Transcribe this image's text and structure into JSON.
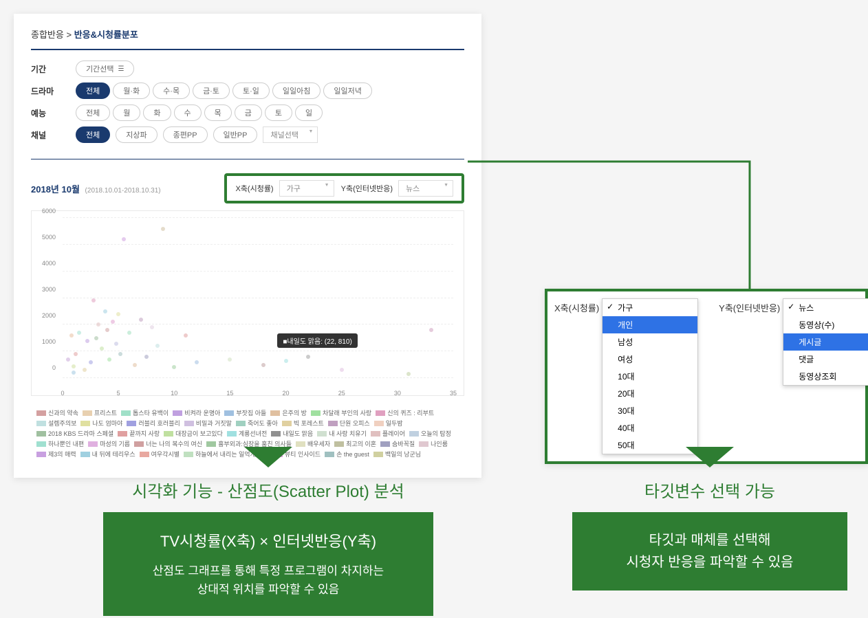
{
  "breadcrumb": {
    "parent": "종합반응",
    "sep": ">",
    "current": "반응&시청률분포"
  },
  "filters": {
    "period_label": "기간",
    "period_button": "기간선택",
    "drama_label": "드라마",
    "drama_options": [
      "전체",
      "월·화",
      "수·목",
      "금·토",
      "토·일",
      "일일아침",
      "일일저녁"
    ],
    "variety_label": "예능",
    "variety_options": [
      "전체",
      "월",
      "화",
      "수",
      "목",
      "금",
      "토",
      "일"
    ],
    "channel_label": "채널",
    "channel_options": [
      "전체",
      "지상파",
      "종편PP",
      "일반PP"
    ],
    "channel_select": "채널선택"
  },
  "date": {
    "title": "2018년 10월",
    "range": "(2018.10.01-2018.10.31)"
  },
  "axis_selectors": {
    "x_label": "X축(시청률)",
    "x_value": "가구",
    "y_label": "Y축(인터넷반응)",
    "y_value": "뉴스"
  },
  "chart_data": {
    "type": "scatter",
    "xlabel": "시청률",
    "ylabel": "인터넷반응",
    "xlim": [
      0,
      35
    ],
    "ylim": [
      0,
      6000
    ],
    "xticks": [
      0,
      5,
      10,
      15,
      20,
      25,
      30,
      35
    ],
    "yticks": [
      0,
      1000,
      2000,
      3000,
      4000,
      5000,
      6000
    ],
    "tooltip": "■내일도 맑음: (22, 810)",
    "points": [
      {
        "x": 0.5,
        "y": 700,
        "c": "#c8a8d8"
      },
      {
        "x": 0.8,
        "y": 1600,
        "c": "#e8c0a0"
      },
      {
        "x": 1.0,
        "y": 200,
        "c": "#a0c8e0"
      },
      {
        "x": 1.0,
        "y": 450,
        "c": "#d0e0a0"
      },
      {
        "x": 1.2,
        "y": 900,
        "c": "#e0a0a0"
      },
      {
        "x": 1.5,
        "y": 1700,
        "c": "#a0e0d0"
      },
      {
        "x": 2.0,
        "y": 300,
        "c": "#e0d0a0"
      },
      {
        "x": 2.2,
        "y": 1400,
        "c": "#c0a0e0"
      },
      {
        "x": 2.5,
        "y": 600,
        "c": "#a0a0e0"
      },
      {
        "x": 2.8,
        "y": 2900,
        "c": "#e0a0c0"
      },
      {
        "x": 3.0,
        "y": 1500,
        "c": "#a0c0a0"
      },
      {
        "x": 3.2,
        "y": 2000,
        "c": "#e0c0c0"
      },
      {
        "x": 3.5,
        "y": 1100,
        "c": "#c0e0a0"
      },
      {
        "x": 3.8,
        "y": 2500,
        "c": "#a0d0e0"
      },
      {
        "x": 4.0,
        "y": 1800,
        "c": "#d0a0a0"
      },
      {
        "x": 4.2,
        "y": 700,
        "c": "#a0e0a0"
      },
      {
        "x": 4.5,
        "y": 2100,
        "c": "#e0a0d0"
      },
      {
        "x": 4.8,
        "y": 1300,
        "c": "#c0c0e0"
      },
      {
        "x": 5.0,
        "y": 2400,
        "c": "#e0e0a0"
      },
      {
        "x": 5.2,
        "y": 900,
        "c": "#a0c0c0"
      },
      {
        "x": 5.5,
        "y": 5200,
        "c": "#d0a0e0"
      },
      {
        "x": 6.0,
        "y": 1700,
        "c": "#a0e0c0"
      },
      {
        "x": 6.5,
        "y": 500,
        "c": "#e0c0a0"
      },
      {
        "x": 7.0,
        "y": 2200,
        "c": "#c0a0c0"
      },
      {
        "x": 7.5,
        "y": 800,
        "c": "#a0a0c0"
      },
      {
        "x": 8.0,
        "y": 1900,
        "c": "#e0d0e0"
      },
      {
        "x": 8.5,
        "y": 1200,
        "c": "#c0e0e0"
      },
      {
        "x": 9.0,
        "y": 5600,
        "c": "#d0c0a0"
      },
      {
        "x": 10.0,
        "y": 400,
        "c": "#a0d0a0"
      },
      {
        "x": 11.0,
        "y": 1600,
        "c": "#e0a0a0"
      },
      {
        "x": 12.0,
        "y": 600,
        "c": "#a0c0e0"
      },
      {
        "x": 15.0,
        "y": 700,
        "c": "#d0e0c0"
      },
      {
        "x": 18.0,
        "y": 500,
        "c": "#c0a0a0"
      },
      {
        "x": 20.0,
        "y": 650,
        "c": "#a0e0e0"
      },
      {
        "x": 22.0,
        "y": 810,
        "c": "#a0a0a0"
      },
      {
        "x": 25.0,
        "y": 300,
        "c": "#e0c0e0"
      },
      {
        "x": 31.0,
        "y": 150,
        "c": "#c0d0a0"
      },
      {
        "x": 33.0,
        "y": 1800,
        "c": "#d0a0c0"
      }
    ],
    "legend": [
      {
        "label": "신과의 약속",
        "c": "#d4a0a0"
      },
      {
        "label": "프리스트",
        "c": "#e8d0b0"
      },
      {
        "label": "톱스타 유백이",
        "c": "#a0e0c8"
      },
      {
        "label": "비켜라 운명아",
        "c": "#c0a0e0"
      },
      {
        "label": "부잣집 아들",
        "c": "#a0c0e0"
      },
      {
        "label": "은주의 방",
        "c": "#e0c0a0"
      },
      {
        "label": "차달래 부인의 사랑",
        "c": "#a0e0a0"
      },
      {
        "label": "신의 퀴즈 : 리부트",
        "c": "#e0a0c0"
      },
      {
        "label": "설렘주의보",
        "c": "#c0e0e0"
      },
      {
        "label": "나도 엄마야",
        "c": "#e0e0a0"
      },
      {
        "label": "러블리 호러블리",
        "c": "#a0a0e0"
      },
      {
        "label": "비밀과 거짓말",
        "c": "#d0c0e0"
      },
      {
        "label": "죽어도 좋아",
        "c": "#a0d0c0"
      },
      {
        "label": "빅 포레스트",
        "c": "#e0d0a0"
      },
      {
        "label": "단원 오피스",
        "c": "#c0a0c0"
      },
      {
        "label": "일두밤",
        "c": "#f0d0c0"
      },
      {
        "label": "2018 KBS 드라마 스페셜",
        "c": "#a0c0a0"
      },
      {
        "label": "끝까지 사랑",
        "c": "#e0a0a0"
      },
      {
        "label": "대장금이 보고있다",
        "c": "#c0e0a0"
      },
      {
        "label": "계룡선녀전",
        "c": "#a0e0e0"
      },
      {
        "label": "내일도 맑음",
        "c": "#909090"
      },
      {
        "label": "내 사랑 치유기",
        "c": "#d0e0d0"
      },
      {
        "label": "플레이어",
        "c": "#e0c0c0"
      },
      {
        "label": "오늘의 탐정",
        "c": "#c0d0e0"
      },
      {
        "label": "하나뿐인 내편",
        "c": "#a0e0d0"
      },
      {
        "label": "마성의 기름",
        "c": "#e0b0e0"
      },
      {
        "label": "너는 나의 복수의 여신",
        "c": "#d0a0a0"
      },
      {
        "label": "흉부외과:심장을 훔친 의사들",
        "c": "#a0c8a0"
      },
      {
        "label": "배우세자",
        "c": "#e0e0c0"
      },
      {
        "label": "최고의 이혼",
        "c": "#c0c0a0"
      },
      {
        "label": "숨바꼭질",
        "c": "#a0a0c0"
      },
      {
        "label": "나인룸",
        "c": "#e0c8d0"
      },
      {
        "label": "제3의 매력",
        "c": "#c8a0e0"
      },
      {
        "label": "내 뒤에 테리우스",
        "c": "#a0d0e0"
      },
      {
        "label": "여우각시별",
        "c": "#e8a8a0"
      },
      {
        "label": "하늘에서 내리는 일억개의 별",
        "c": "#c0e0c0"
      },
      {
        "label": "뷰티 인사이드",
        "c": "#e0a0e0"
      },
      {
        "label": "손 the guest",
        "c": "#a0c0c0"
      },
      {
        "label": "백일의 낭군님",
        "c": "#d0d0a0"
      }
    ]
  },
  "dropdown_panel": {
    "x_label": "X축(시청률)",
    "x_items": [
      "가구",
      "개인",
      "남성",
      "여성",
      "10대",
      "20대",
      "30대",
      "40대",
      "50대"
    ],
    "x_checked": "가구",
    "x_highlight": "개인",
    "y_label": "Y축(인터넷반응)",
    "y_items": [
      "뉴스",
      "동영상(수)",
      "게시글",
      "댓글",
      "동영상조회"
    ],
    "y_checked": "뉴스",
    "y_highlight": "게시글"
  },
  "left_caption": {
    "title": "시각화 기능 - 산점도(Scatter Plot) 분석",
    "main": "TV시청률(X축) × 인터넷반응(Y축)",
    "sub1": "산점도 그래프를 통해 특정 프로그램이 차지하는",
    "sub2": "상대적 위치를 파악할 수 있음"
  },
  "right_caption": {
    "title": "타깃변수 선택 가능",
    "main1": "타깃과 매체를 선택해",
    "main2": "시청자 반응을 파악할 수 있음"
  }
}
